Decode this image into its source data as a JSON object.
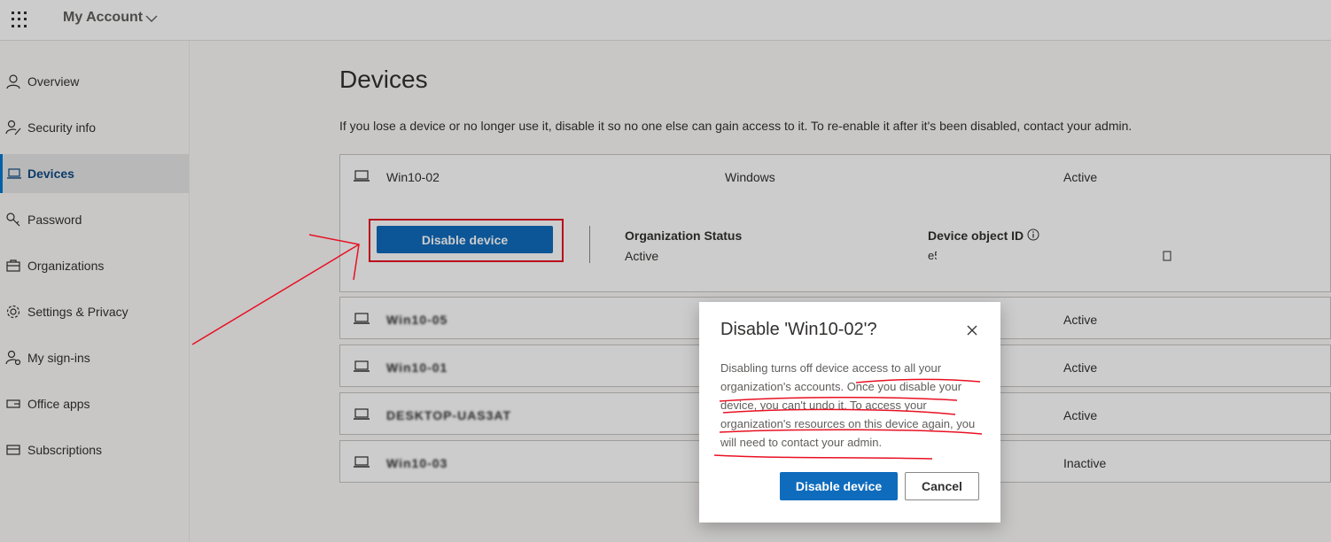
{
  "header": {
    "app_title": "My Account"
  },
  "sidebar": {
    "items": [
      {
        "label": "Overview",
        "icon": "person-icon",
        "active": false
      },
      {
        "label": "Security info",
        "icon": "security-info-icon",
        "active": false
      },
      {
        "label": "Devices",
        "icon": "laptop-icon",
        "active": true
      },
      {
        "label": "Password",
        "icon": "key-icon",
        "active": false
      },
      {
        "label": "Organizations",
        "icon": "briefcase-icon",
        "active": false
      },
      {
        "label": "Settings & Privacy",
        "icon": "gear-icon",
        "active": false
      },
      {
        "label": "My sign-ins",
        "icon": "sign-ins-icon",
        "active": false
      },
      {
        "label": "Office apps",
        "icon": "office-apps-icon",
        "active": false
      },
      {
        "label": "Subscriptions",
        "icon": "subscriptions-icon",
        "active": false
      }
    ]
  },
  "main": {
    "title": "Devices",
    "description": "If you lose a device or no longer use it, disable it so no one else can gain access to it. To re-enable it after it's been disabled, contact your admin.",
    "devices": [
      {
        "name": "Win10-02",
        "os": "Windows",
        "status": "Active",
        "expanded": true
      },
      {
        "name": "Win10-05",
        "os": "",
        "status": "Active",
        "blurred": true
      },
      {
        "name": "Win10-01",
        "os": "",
        "status": "Active",
        "blurred": true
      },
      {
        "name": "DESKTOP-UAS3AT",
        "os": "",
        "status": "Active",
        "blurred": true
      },
      {
        "name": "Win10-03",
        "os": "",
        "status": "Inactive",
        "blurred": true
      }
    ],
    "expanded": {
      "disable_button": "Disable device",
      "org_status_label": "Organization Status",
      "org_status_value": "Active",
      "device_id_label": "Device object ID",
      "device_id_value": "e5"
    }
  },
  "dialog": {
    "title": "Disable 'Win10-02'?",
    "body_plain": "Disabling turns off device access to all your organization's accounts. ",
    "body_underlined": "Once you disable your device, you can't undo it. To access your organization's resources on this device again, you will need to contact your admin.",
    "confirm_label": "Disable device",
    "cancel_label": "Cancel"
  },
  "colors": {
    "accent": "#0f6cbd",
    "annotation_red": "#e81123",
    "active_nav": "#0f4a85"
  }
}
